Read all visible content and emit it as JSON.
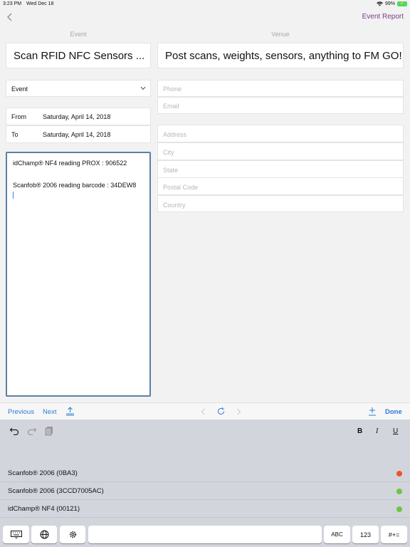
{
  "status_bar": {
    "time": "3:23 PM",
    "date": "Wed Dec 18",
    "battery": "99%"
  },
  "nav": {
    "report_link": "Event Report"
  },
  "columns": {
    "event_label": "Event",
    "venue_label": "Venue"
  },
  "event": {
    "title": "Scan RFID NFC Sensors ...",
    "type_select": "Event",
    "from_label": "From",
    "from_value": "Saturday, April 14, 2018",
    "to_label": "To",
    "to_value": "Saturday, April 14, 2018",
    "notes_line1": "idChamp® NF4 reading PROX : 906522",
    "notes_line2": "Scanfob® 2006 reading barcode : 34DEW8"
  },
  "venue": {
    "title": "Post scans, weights, sensors, anything to FM GO!",
    "phone_placeholder": "Phone",
    "email_placeholder": "Email",
    "address_placeholder": "Address",
    "city_placeholder": "City",
    "state_placeholder": "State",
    "postal_placeholder": "Postal Code",
    "country_placeholder": "Country"
  },
  "accessory": {
    "previous": "Previous",
    "next": "Next",
    "done": "Done"
  },
  "format": {
    "bold": "B",
    "italic": "I",
    "underline": "U"
  },
  "devices": [
    {
      "name": "Scanfob® 2006 (0BA3)",
      "status_color": "#f0522d"
    },
    {
      "name": "Scanfob® 2006 (3CCD7005AC)",
      "status_color": "#6cc644"
    },
    {
      "name": "idChamp® NF4 (00121)",
      "status_color": "#6cc644"
    }
  ],
  "keyboard": {
    "abc": "ABC",
    "num": "123",
    "sym": "#+="
  }
}
